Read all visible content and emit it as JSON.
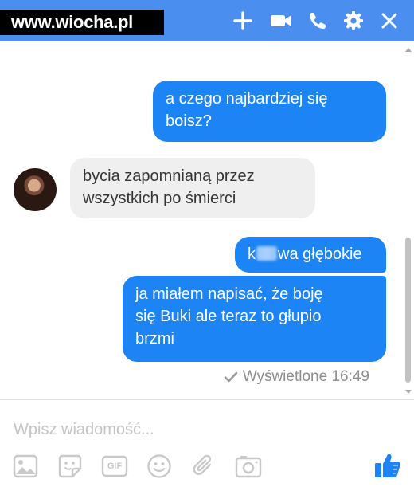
{
  "header": {
    "watermark": "www.wiocha.pl",
    "icons": [
      "plus-icon",
      "video-camera-icon",
      "phone-icon",
      "gear-icon",
      "close-icon"
    ],
    "color": "#4a8ff0"
  },
  "messages": [
    {
      "direction": "outgoing",
      "lines": [
        "a czego najbardziej się",
        "boisz?"
      ]
    },
    {
      "direction": "incoming",
      "lines": [
        "bycia zapomnianą przez",
        "wszystkich po śmierci"
      ]
    },
    {
      "direction": "outgoing",
      "prefix": "k",
      "suffix": "wa głębokie"
    },
    {
      "direction": "outgoing",
      "lines": [
        "ja miałem napisać, że boję",
        "się Buki ale teraz to głupio",
        "brzmi"
      ]
    }
  ],
  "seen_status": "Wyświetlone 16:49",
  "composer": {
    "placeholder": "Wpisz wiadomość..."
  },
  "toolbar": {
    "icons": [
      "image-icon",
      "sticker-icon",
      "gif-icon",
      "emoji-icon",
      "attachment-icon",
      "camera-icon",
      "like-icon"
    ],
    "gif_label": "GIF"
  },
  "colors": {
    "outgoing": "#1d84f5",
    "incoming": "#efefef",
    "accent": "#4a8ff0"
  }
}
